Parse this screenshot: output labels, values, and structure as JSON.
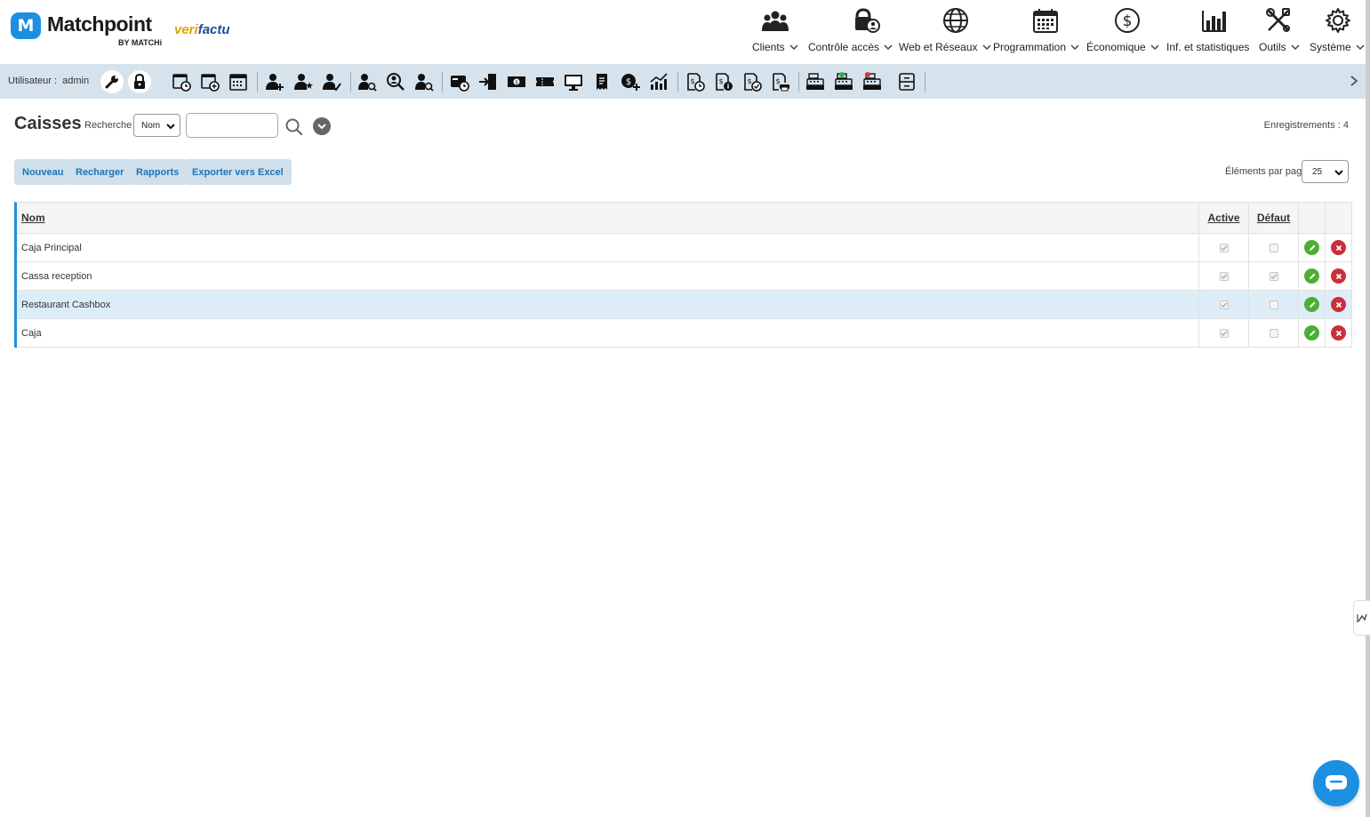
{
  "brand": {
    "logo_letter": "M",
    "name": "Matchpoint",
    "by": "BY MATCHi",
    "partner_prefix": "veri",
    "partner_suffix": "factu",
    "accent_color": "#1c8fe0"
  },
  "topnav": [
    {
      "label": "Clients",
      "icon": "users-icon",
      "dropdown": true
    },
    {
      "label": "Contrôle accès",
      "icon": "access-control-icon",
      "dropdown": true
    },
    {
      "label": "Web et Réseaux",
      "icon": "globe-icon",
      "dropdown": true
    },
    {
      "label": "Programmation",
      "icon": "calendar-icon",
      "dropdown": true
    },
    {
      "label": "Économique",
      "icon": "dollar-icon",
      "dropdown": true
    },
    {
      "label": "Inf. et statistiques",
      "icon": "bar-chart-icon",
      "dropdown": false
    },
    {
      "label": "Outils",
      "icon": "tools-icon",
      "dropdown": true
    },
    {
      "label": "Système",
      "icon": "gear-icon",
      "dropdown": true
    }
  ],
  "toolbar": {
    "user_label": "Utilisateur :",
    "user_name": "admin"
  },
  "page": {
    "title": "Caisses",
    "search_label": "Recherche",
    "search_field": "Nom",
    "search_value": "",
    "records_label": "Enregistrements : 4"
  },
  "actions": {
    "new": "Nouveau",
    "reload": "Recharger",
    "reports": "Rapports",
    "export": "Exporter vers Excel",
    "per_page_label": "Éléments par page",
    "per_page_value": "25"
  },
  "table": {
    "columns": {
      "name": "Nom",
      "active": "Active",
      "default": "Défaut"
    },
    "rows": [
      {
        "name": "Caja Principal",
        "active": true,
        "default": false
      },
      {
        "name": "Cassa reception",
        "active": true,
        "default": true
      },
      {
        "name": "Restaurant Cashbox",
        "active": true,
        "default": false
      },
      {
        "name": "Caja",
        "active": true,
        "default": false
      }
    ]
  },
  "colors": {
    "toolbar_bg": "#d7e3ec",
    "button_bg": "#cfe0ec",
    "button_text": "#1d74b8",
    "edit": "#4caf34",
    "delete": "#c9303c",
    "row_highlight": "#ddedf7"
  }
}
